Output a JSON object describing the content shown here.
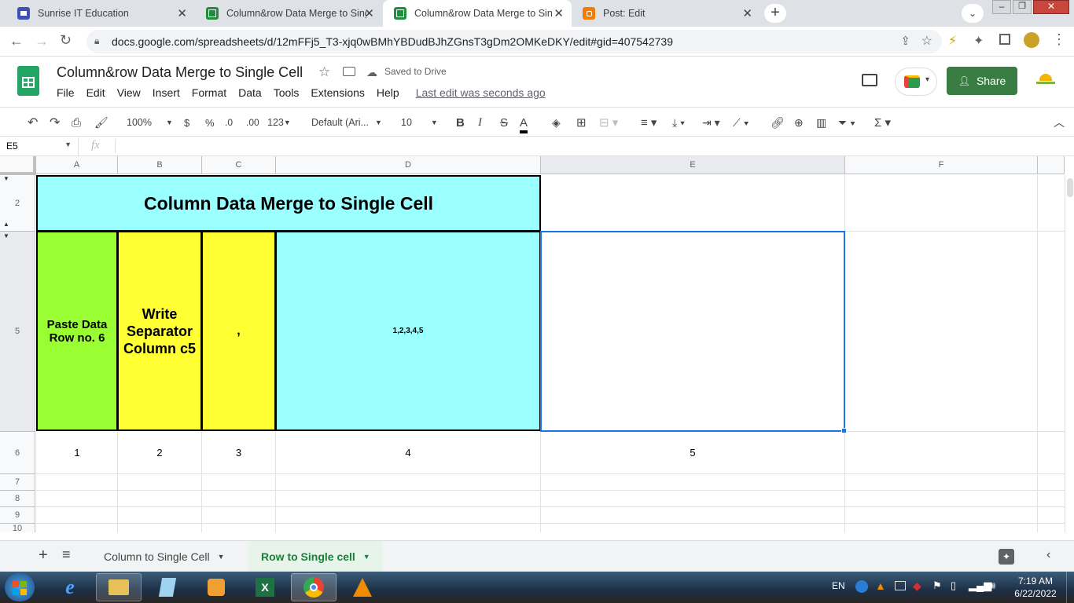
{
  "browser": {
    "tabs": [
      {
        "title": "Sunrise IT Education",
        "icon": "sunrise-icon"
      },
      {
        "title": "Column&row Data Merge to Sing",
        "icon": "sheets-icon"
      },
      {
        "title": "Column&row Data Merge to Sing",
        "icon": "sheets-icon"
      },
      {
        "title": "Post: Edit",
        "icon": "blogger-icon"
      }
    ],
    "url": "docs.google.com/spreadsheets/d/12mFFj5_T3-xjq0wBMhYBDudBJhZGnsT3gDm2OMKeDKY/edit#gid=407542739"
  },
  "doc": {
    "title": "Column&row Data Merge to Single Cell",
    "saved": "Saved to Drive",
    "menus": [
      "File",
      "Edit",
      "View",
      "Insert",
      "Format",
      "Data",
      "Tools",
      "Extensions",
      "Help"
    ],
    "last_edit": "Last edit was seconds ago",
    "share": "Share"
  },
  "toolbar": {
    "zoom": "100%",
    "currency": "$",
    "percent": "%",
    "dec_less": ".0",
    "dec_more": ".00",
    "format": "123",
    "font": "Default (Ari...",
    "size": "10"
  },
  "formula_bar": {
    "cell_ref": "E5",
    "fx": "fx",
    "value": ""
  },
  "columns": [
    "A",
    "B",
    "C",
    "D",
    "E",
    "F"
  ],
  "rows": [
    "2",
    "5",
    "6",
    "7",
    "8",
    "9",
    "10"
  ],
  "cells": {
    "title": "Column Data Merge to Single Cell",
    "a5": "Paste Data Row no. 6",
    "b5": "Write Separator Column c5",
    "c5": ",",
    "d5": "1,2,3,4,5",
    "e5": "",
    "row6": [
      "1",
      "2",
      "3",
      "4",
      "5"
    ]
  },
  "colors": {
    "cyan": "#99ffff",
    "green": "#99ff33",
    "yellow": "#ffff33",
    "selection": "#1a73e8",
    "share_bg": "#3a7d44"
  },
  "sheets": [
    {
      "name": "Column to Single Cell",
      "active": false
    },
    {
      "name": "Row to Single cell",
      "active": true
    }
  ],
  "taskbar": {
    "lang": "EN",
    "time": "7:19 AM",
    "date": "6/22/2022"
  }
}
